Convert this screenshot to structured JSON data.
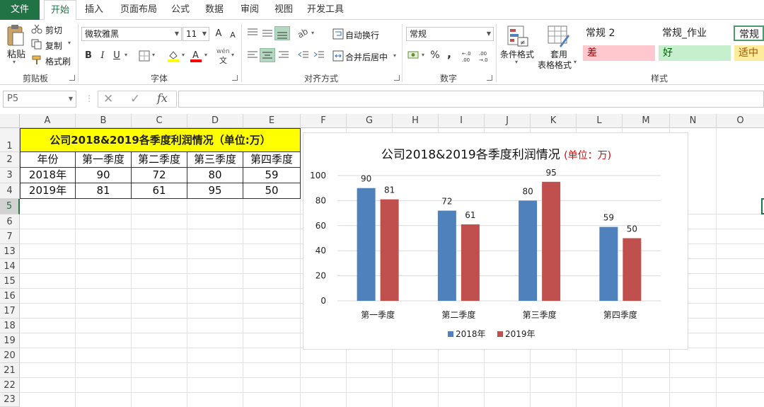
{
  "ribbon_tabs": [
    "文件",
    "开始",
    "插入",
    "页面布局",
    "公式",
    "数据",
    "审阅",
    "视图",
    "开发工具"
  ],
  "clipboard": {
    "paste": "粘贴",
    "cut": "剪切",
    "copy": "复制",
    "format_painter": "格式刷",
    "label": "剪贴板"
  },
  "font": {
    "name": "微软雅黑",
    "size": "11",
    "grow": "A",
    "shrink": "A",
    "bold": "B",
    "italic": "I",
    "underline": "U",
    "phonetic": "wén",
    "label": "字体"
  },
  "alignment": {
    "wrap_text": "自动换行",
    "merge_center": "合并后居中",
    "label": "对齐方式"
  },
  "number": {
    "format": "常规",
    "percent": "%",
    "comma": ",",
    "label": "数字"
  },
  "styles": {
    "conditional": "条件格式",
    "table_format_l1": "套用",
    "table_format_l2": "表格格式",
    "cells": [
      {
        "text": "常规 2",
        "bg": "#ffffff",
        "color": "#222222"
      },
      {
        "text": "常规_作业",
        "bg": "#ffffff",
        "color": "#222222"
      },
      {
        "text": "常规",
        "bg": "#ffffff",
        "color": "#222222"
      },
      {
        "text": "差",
        "bg": "#ffc7ce",
        "color": "#9c0006"
      },
      {
        "text": "好",
        "bg": "#c6efce",
        "color": "#006100"
      },
      {
        "text": "适中",
        "bg": "#ffeb9c",
        "color": "#9c5700"
      }
    ],
    "label": "样式"
  },
  "formula_bar": {
    "name_box": "P5",
    "fx": "fx",
    "formula": ""
  },
  "columns": [
    "A",
    "B",
    "C",
    "D",
    "E",
    "F",
    "G",
    "H",
    "I",
    "J",
    "K",
    "L",
    "M",
    "N",
    "O"
  ],
  "rows": [
    "1",
    "2",
    "3",
    "4",
    "5",
    "6",
    "7",
    "13",
    "14",
    "15",
    "16",
    "17",
    "18",
    "19",
    "20",
    "21",
    "22",
    "23"
  ],
  "table": {
    "title": "公司2018&2019各季度利润情况（单位:万）",
    "header": [
      "年份",
      "第一季度",
      "第二季度",
      "第三季度",
      "第四季度"
    ],
    "rows": [
      [
        "2018年",
        "90",
        "72",
        "80",
        "59"
      ],
      [
        "2019年",
        "81",
        "61",
        "95",
        "50"
      ]
    ]
  },
  "chart_data": {
    "type": "bar",
    "title": "公司2018&2019各季度利润情况",
    "title_unit": "(单位：万)",
    "categories": [
      "第一季度",
      "第二季度",
      "第三季度",
      "第四季度"
    ],
    "series": [
      {
        "name": "2018年",
        "values": [
          90,
          72,
          80,
          59
        ],
        "color": "#4f81bd"
      },
      {
        "name": "2019年",
        "values": [
          81,
          61,
          95,
          50
        ],
        "color": "#c0504d"
      }
    ],
    "yticks": [
      "0",
      "20",
      "40",
      "60",
      "80",
      "100"
    ],
    "ylim": [
      0,
      100
    ],
    "grid": true,
    "legend": "bottom",
    "data_labels": true
  },
  "colors": {
    "accent": "#217346",
    "title_fill": "#ffff00"
  }
}
